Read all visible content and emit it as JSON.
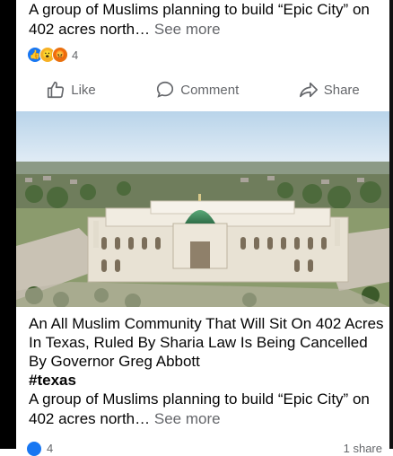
{
  "post_top": {
    "text": "A group of Muslims planning to build “Epic City” on 402 acres north…",
    "see_more": "See more",
    "reaction_count": "4"
  },
  "actions": {
    "like": "Like",
    "comment": "Comment",
    "share": "Share"
  },
  "post_main": {
    "title": "An All Muslim Community That Will Sit On 402 Acres In Texas, Ruled By Sharia Law Is Being Cancelled By Governor Greg Abbott",
    "hashtag": "#texas",
    "text": "A group of Muslims planning to build “Epic City” on 402 acres north…",
    "see_more": "See more",
    "reaction_count": "4",
    "shares": "1 share"
  },
  "colors": {
    "like_blue": "#1877f2",
    "meta_gray": "#65676b",
    "dome_green": "#3f8a5c"
  }
}
